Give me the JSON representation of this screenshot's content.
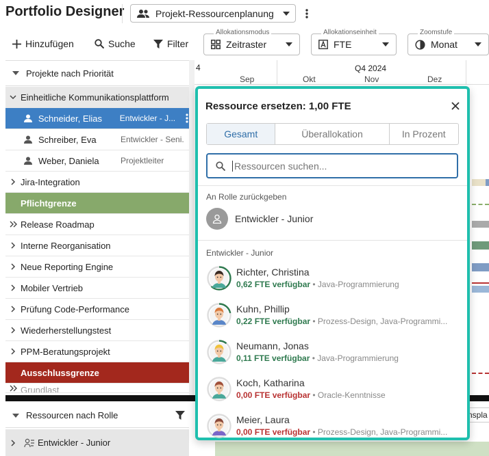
{
  "app": {
    "title": "Portfolio Designer"
  },
  "project_selector": {
    "label": "Projekt-Ressourcenplanung"
  },
  "toolbar": {
    "add_label": "Hinzufügen",
    "search_label": "Suche",
    "filter_label": "Filter",
    "allocation_mode": {
      "legend": "Allokationsmodus",
      "value": "Zeitraster"
    },
    "allocation_unit": {
      "legend": "Allokationseinheit",
      "value": "FTE"
    },
    "zoom": {
      "legend": "Zoomstufe",
      "value": "Monat"
    }
  },
  "left_panel": {
    "projects_header": "Projekte nach Priorität",
    "rows": [
      {
        "label": "Einheitliche Kommunikationsplattform",
        "type": "expanded"
      },
      {
        "label": "Schneider, Elias",
        "role": "Entwickler - J...",
        "type": "person",
        "selected": true
      },
      {
        "label": "Schreiber, Eva",
        "role": "Entwickler - Seni...",
        "type": "person"
      },
      {
        "label": "Weber, Daniela",
        "role": "Projektleiter",
        "type": "person"
      },
      {
        "label": "Jira-Integration",
        "type": "collapsed"
      },
      {
        "label": "Pflichtgrenze",
        "type": "boundary-green"
      },
      {
        "label": "Release Roadmap",
        "type": "double"
      },
      {
        "label": "Interne Reorganisation",
        "type": "collapsed"
      },
      {
        "label": "Neue Reporting Engine",
        "type": "collapsed"
      },
      {
        "label": "Mobiler Vertrieb",
        "type": "collapsed"
      },
      {
        "label": "Prüfung Code-Performance",
        "type": "collapsed"
      },
      {
        "label": "Wiederherstellungstest",
        "type": "collapsed"
      },
      {
        "label": "PPM-Beratungsprojekt",
        "type": "collapsed"
      },
      {
        "label": "Ausschlussgrenze",
        "type": "boundary-red"
      },
      {
        "label": "Grundlast",
        "type": "double"
      }
    ],
    "resources_header": "Ressourcen nach Rolle",
    "resource_group": "Entwickler - Junior"
  },
  "timeline": {
    "left_fragment": "4",
    "quarter": "Q4 2024",
    "months": [
      "Sep",
      "Okt",
      "Nov",
      "Dez"
    ],
    "right_fragment": "nspla"
  },
  "popup": {
    "title": "Ressource ersetzen: 1,00 FTE",
    "tabs": [
      "Gesamt",
      "Überallokation",
      "In Prozent"
    ],
    "search_placeholder": "Ressourcen suchen...",
    "return_section": "An Rolle zurückgeben",
    "return_role": "Entwickler - Junior",
    "list_section": "Entwickler - Junior",
    "resources": [
      {
        "name": "Richter, Christina",
        "avail": "0,62 FTE verfügbar",
        "skills": " • Java-Programmierung",
        "status": "green",
        "ring_color": "#2f7a4f",
        "hair": "#3a2a22",
        "shirt": "#4aa89a",
        "fill": 0.62
      },
      {
        "name": "Kuhn, Phillip",
        "avail": "0,22 FTE verfügbar",
        "skills": " • Prozess-Design, Java-Programmi...",
        "status": "green",
        "ring_color": "#2f7a4f",
        "hair": "#d9793b",
        "shirt": "#5a86c8",
        "fill": 0.22
      },
      {
        "name": "Neumann, Jonas",
        "avail": "0,11 FTE verfügbar",
        "skills": " • Java-Programmierung",
        "status": "green",
        "ring_color": "#2f7a4f",
        "hair": "#f0c13a",
        "shirt": "#4aa89a",
        "fill": 0.11
      },
      {
        "name": "Koch, Katharina",
        "avail": "0,00 FTE verfügbar",
        "skills": " • Oracle-Kenntnisse",
        "status": "red",
        "ring_color": "#b83232",
        "hair": "#a0503a",
        "shirt": "#4aa89a",
        "fill": 0
      },
      {
        "name": "Meier, Laura",
        "avail": "0,00 FTE verfügbar",
        "skills": " • Prozess-Design, Java-Programmi...",
        "status": "red",
        "ring_color": "#b83232",
        "hair": "#8a4a3a",
        "shirt": "#7b66c8",
        "fill": 0
      }
    ]
  }
}
